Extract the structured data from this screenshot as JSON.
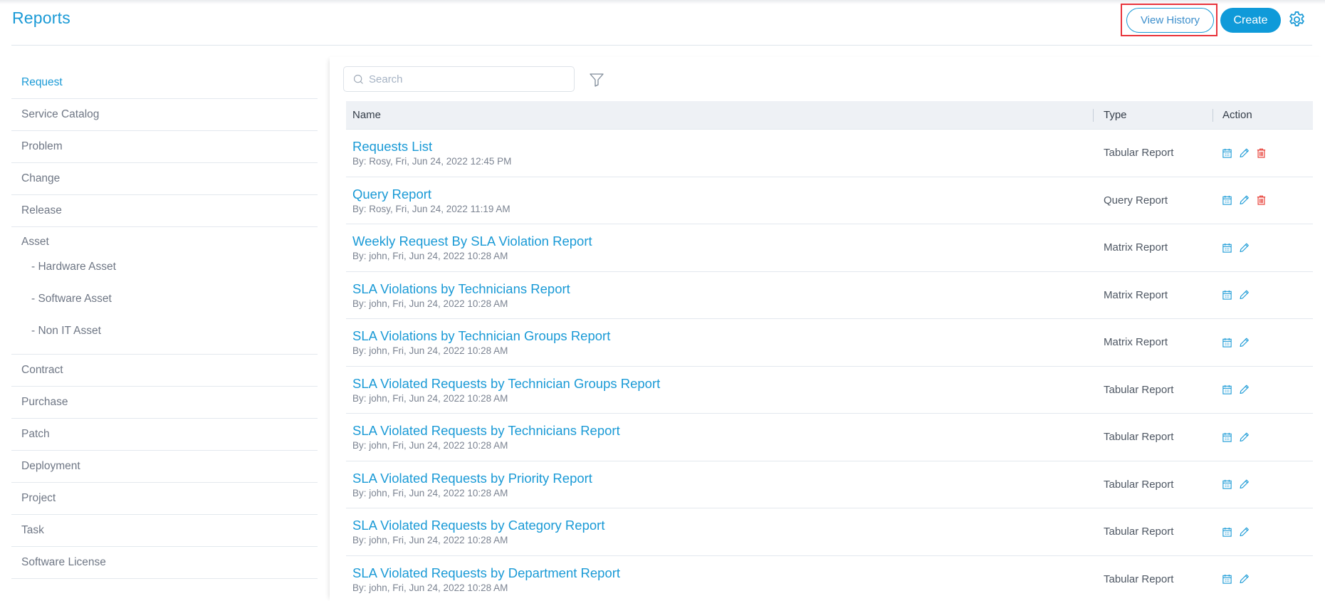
{
  "header": {
    "title": "Reports",
    "view_history_label": "View History",
    "create_label": "Create",
    "settings_icon": "gear-icon"
  },
  "colors": {
    "accent": "#1a9ad6",
    "primary_button": "#0f9ad9",
    "delete": "#e8473f",
    "highlight_box": "#e8333b"
  },
  "sidebar": {
    "items": [
      {
        "label": "Request",
        "active": true
      },
      {
        "label": "Service Catalog"
      },
      {
        "label": "Problem"
      },
      {
        "label": "Change"
      },
      {
        "label": "Release"
      }
    ],
    "asset_group": {
      "label": "Asset",
      "children": [
        "- Hardware Asset",
        "- Software Asset",
        "- Non IT Asset"
      ]
    },
    "items_after": [
      {
        "label": "Contract"
      },
      {
        "label": "Purchase"
      },
      {
        "label": "Patch"
      },
      {
        "label": "Deployment"
      },
      {
        "label": "Project"
      },
      {
        "label": "Task"
      },
      {
        "label": "Software License"
      }
    ]
  },
  "search": {
    "placeholder": "Search",
    "value": ""
  },
  "table": {
    "columns": [
      "Name",
      "Type",
      "Action"
    ],
    "rows": [
      {
        "name": "Requests List",
        "meta": "By: Rosy, Fri, Jun 24, 2022 12:45 PM",
        "type": "Tabular Report",
        "actions": [
          "schedule",
          "edit",
          "delete"
        ]
      },
      {
        "name": "Query Report",
        "meta": "By: Rosy, Fri, Jun 24, 2022 11:19 AM",
        "type": "Query Report",
        "actions": [
          "schedule",
          "edit",
          "delete"
        ]
      },
      {
        "name": "Weekly Request By SLA Violation Report",
        "meta": "By: john, Fri, Jun 24, 2022 10:28 AM",
        "type": "Matrix Report",
        "actions": [
          "schedule",
          "edit"
        ]
      },
      {
        "name": "SLA Violations by Technicians Report",
        "meta": "By: john, Fri, Jun 24, 2022 10:28 AM",
        "type": "Matrix Report",
        "actions": [
          "schedule",
          "edit"
        ]
      },
      {
        "name": "SLA Violations by Technician Groups Report",
        "meta": "By: john, Fri, Jun 24, 2022 10:28 AM",
        "type": "Matrix Report",
        "actions": [
          "schedule",
          "edit"
        ]
      },
      {
        "name": "SLA Violated Requests by Technician Groups Report",
        "meta": "By: john, Fri, Jun 24, 2022 10:28 AM",
        "type": "Tabular Report",
        "actions": [
          "schedule",
          "edit"
        ]
      },
      {
        "name": "SLA Violated Requests by Technicians Report",
        "meta": "By: john, Fri, Jun 24, 2022 10:28 AM",
        "type": "Tabular Report",
        "actions": [
          "schedule",
          "edit"
        ]
      },
      {
        "name": "SLA Violated Requests by Priority Report",
        "meta": "By: john, Fri, Jun 24, 2022 10:28 AM",
        "type": "Tabular Report",
        "actions": [
          "schedule",
          "edit"
        ]
      },
      {
        "name": "SLA Violated Requests by Category Report",
        "meta": "By: john, Fri, Jun 24, 2022 10:28 AM",
        "type": "Tabular Report",
        "actions": [
          "schedule",
          "edit"
        ]
      },
      {
        "name": "SLA Violated Requests by Department Report",
        "meta": "By: john, Fri, Jun 24, 2022 10:28 AM",
        "type": "Tabular Report",
        "actions": [
          "schedule",
          "edit"
        ]
      }
    ]
  }
}
